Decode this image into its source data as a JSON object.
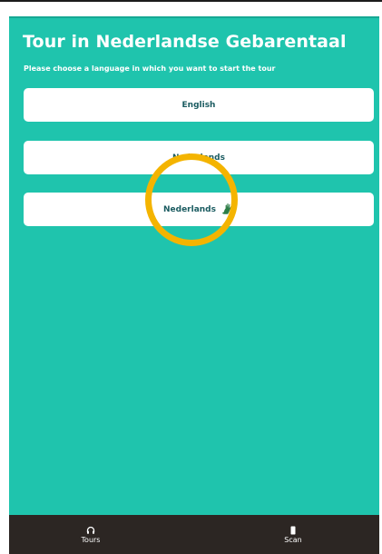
{
  "header": {
    "title": "Tour in Nederlandse Gebarentaal",
    "subtitle": "Please choose a language in which you want to start the tour"
  },
  "languages": [
    {
      "label": "English"
    },
    {
      "label": "Nederlands"
    },
    {
      "label": "Nederlands",
      "icon": "sign-language-icon"
    }
  ],
  "bottom_nav": {
    "items": [
      {
        "label": "Tours",
        "icon": "headphones-icon"
      },
      {
        "label": "Scan",
        "icon": "phone-icon"
      }
    ]
  },
  "colors": {
    "background": "#1fc4ad",
    "button": "#ffffff",
    "button_text": "#1a5b60",
    "nav_bar": "#2c2623",
    "highlight": "#f4b400"
  }
}
